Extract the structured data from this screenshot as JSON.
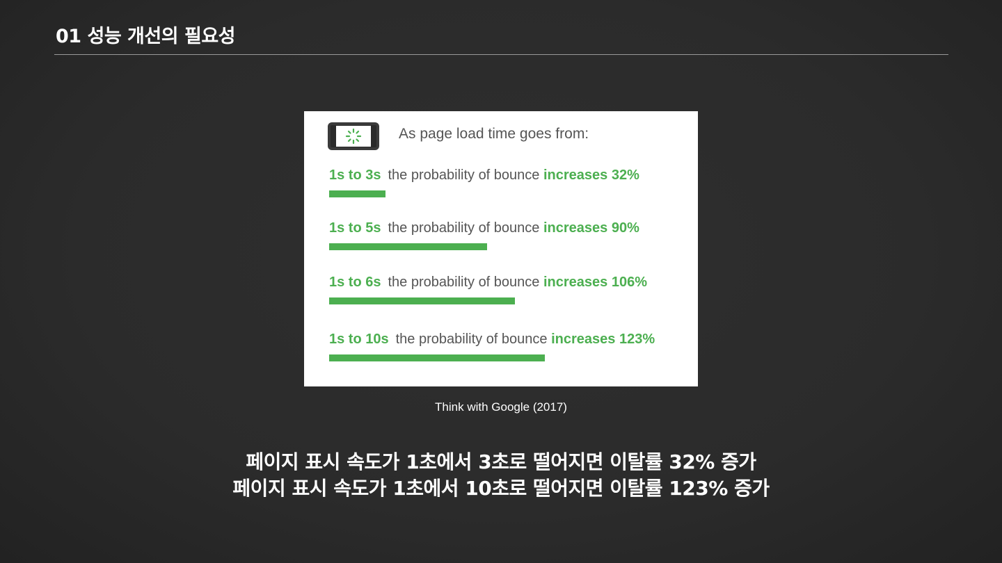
{
  "slide": {
    "title": "01 성능 개선의 필요성",
    "source": "Think with Google (2017)",
    "summary_lines": [
      "페이지 표시 속도가 1초에서 3초로 떨어지면 이탈률 32% 증가",
      "페이지 표시 속도가 1초에서 10초로 떨어지면 이탈률 123% 증가"
    ]
  },
  "colors": {
    "accent_green": "#4caf50",
    "text_gray": "#555555",
    "background": "#2b2b2b"
  },
  "icons": {
    "phone": "phone-loading-icon"
  },
  "chart_data": {
    "type": "bar",
    "title": "As page load time goes from:",
    "categories": [
      "1s to 3s",
      "1s to 5s",
      "1s to 6s",
      "1s to 10s"
    ],
    "series": [
      {
        "values": [
          32,
          90,
          106,
          123
        ]
      }
    ],
    "labels": [
      {
        "description": "the probability of bounce",
        "increase": "increases 32%"
      },
      {
        "description": "the probability of bounce",
        "increase": "increases 90%"
      },
      {
        "description": "the probability of bounce",
        "increase": "increases 106%"
      },
      {
        "description": "the probability of bounce",
        "increase": "increases 123%"
      }
    ],
    "ylim": [
      0,
      123
    ],
    "grid": false,
    "legend": "none"
  }
}
